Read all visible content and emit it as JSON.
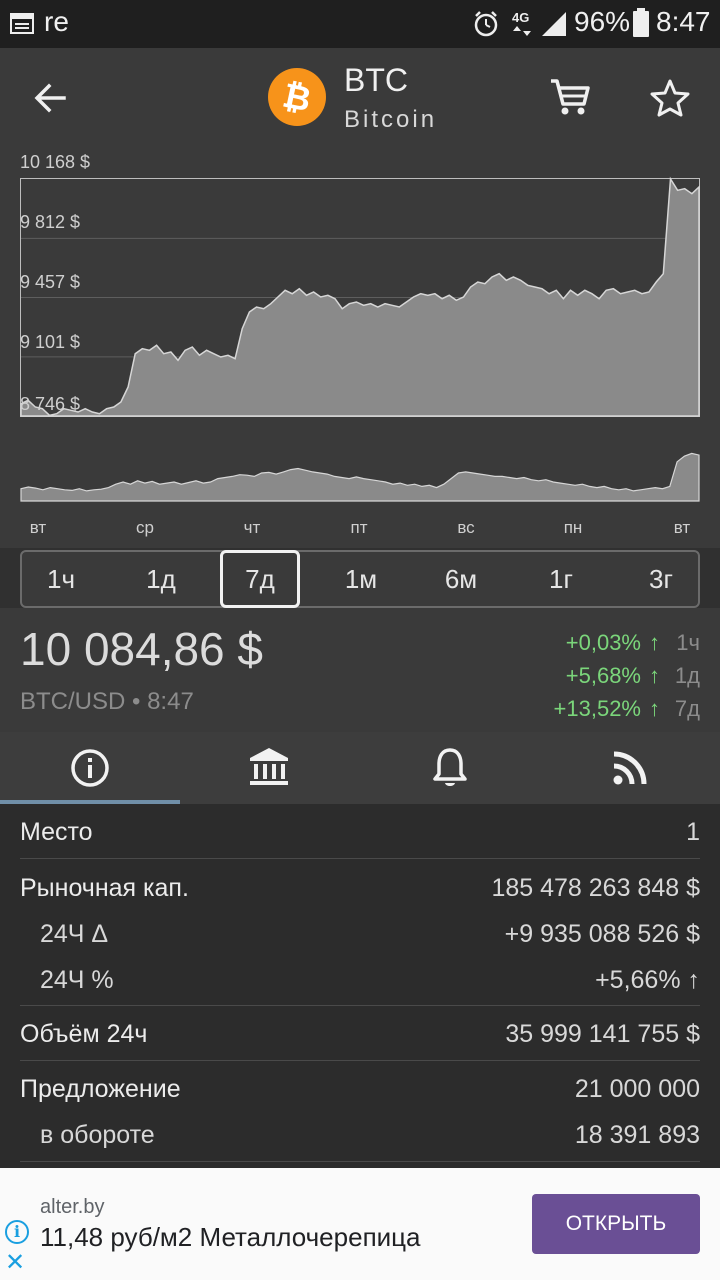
{
  "status_bar": {
    "app_text": "re",
    "network": "4G",
    "battery": "96%",
    "time": "8:47"
  },
  "header": {
    "symbol": "BTC",
    "name": "Bitcoin",
    "coin_color": "#f7931a"
  },
  "chart": {
    "y_labels": [
      "10 168 $",
      "9 812 $",
      "9 457 $",
      "9 101 $",
      "8 746 $"
    ],
    "x_labels": [
      "вт",
      "ср",
      "чт",
      "пт",
      "вс",
      "пн",
      "вт"
    ]
  },
  "chart_data": {
    "type": "area",
    "ylim": [
      8746,
      10168
    ],
    "yticks": [
      8746,
      9101,
      9457,
      9812,
      10168
    ],
    "x": [
      "вт",
      "ср",
      "чт",
      "пт",
      "вс",
      "пн",
      "вт"
    ],
    "series": [
      {
        "values": [
          8820,
          8840,
          8800,
          8790,
          8750,
          8760,
          8790,
          8780,
          8770,
          8790,
          8770,
          8760,
          8790,
          8800,
          8830,
          8920,
          9120,
          9150,
          9140,
          9170,
          9120,
          9130,
          9080,
          9140,
          9160,
          9110,
          9140,
          9120,
          9100,
          9110,
          9090,
          9270,
          9370,
          9400,
          9390,
          9420,
          9460,
          9500,
          9480,
          9510,
          9470,
          9490,
          9460,
          9470,
          9450,
          9390,
          9420,
          9430,
          9410,
          9420,
          9400,
          9420,
          9410,
          9400,
          9430,
          9460,
          9480,
          9470,
          9480,
          9450,
          9470,
          9440,
          9460,
          9520,
          9550,
          9540,
          9580,
          9600,
          9560,
          9580,
          9560,
          9530,
          9520,
          9510,
          9480,
          9500,
          9450,
          9500,
          9470,
          9500,
          9480,
          9450,
          9500,
          9510,
          9480,
          9490,
          9500,
          9480,
          9490,
          9550,
          9600,
          10168,
          10100,
          10110,
          10080,
          10120
        ]
      }
    ],
    "volume_values": [
      22,
      25,
      23,
      20,
      24,
      22,
      20,
      19,
      22,
      18,
      20,
      21,
      24,
      30,
      34,
      30,
      36,
      32,
      35,
      30,
      32,
      34,
      30,
      33,
      36,
      32,
      34,
      40,
      42,
      44,
      47,
      46,
      44,
      50,
      51,
      48,
      52,
      56,
      58,
      55,
      52,
      50,
      48,
      44,
      42,
      40,
      43,
      40,
      38,
      36,
      34,
      30,
      32,
      28,
      30,
      26,
      28,
      24,
      30,
      40,
      50,
      52,
      50,
      48,
      46,
      44,
      44,
      42,
      40,
      42,
      38,
      36,
      38,
      34,
      32,
      30,
      28,
      30,
      26,
      24,
      26,
      22,
      20,
      22,
      18,
      20,
      22,
      24,
      22,
      26,
      70,
      80,
      85,
      82
    ]
  },
  "ranges": {
    "items": [
      "1ч",
      "1д",
      "7д",
      "1м",
      "6м",
      "1г",
      "3г"
    ],
    "active_index": 2
  },
  "price": {
    "value": "10 084,86 $",
    "pair": "BTC/USD • 8:47",
    "changes": [
      {
        "value": "+0,03%",
        "arrow": "↑",
        "period": "1ч"
      },
      {
        "value": "+5,68%",
        "arrow": "↑",
        "period": "1д"
      },
      {
        "value": "+13,52%",
        "arrow": "↑",
        "period": "7д"
      }
    ]
  },
  "tabs": {
    "items": [
      "info-icon",
      "exchange-icon",
      "bell-icon",
      "rss-icon"
    ],
    "active_index": 0
  },
  "info": {
    "rank_label": "Место",
    "rank_value": "1",
    "mcap_label": "Рыночная кап.",
    "mcap_value": "185 478 263 848 $",
    "d24_label": "24Ч Δ",
    "d24_value": "+9 935 088 526 $",
    "p24_label": "24Ч %",
    "p24_value": "+5,66% ↑",
    "vol_label": "Объём 24ч",
    "vol_value": "35 999 141 755 $",
    "supply_label": "Предложение",
    "supply_value": "21 000 000",
    "circ_label": "в обороте",
    "circ_value": "18 391 893"
  },
  "ad": {
    "domain": "alter.by",
    "title": "11,48 руб/м2 Металлочерепица",
    "button": "ОТКРЫТЬ",
    "info_glyph": "i",
    "close_glyph": "✕"
  }
}
